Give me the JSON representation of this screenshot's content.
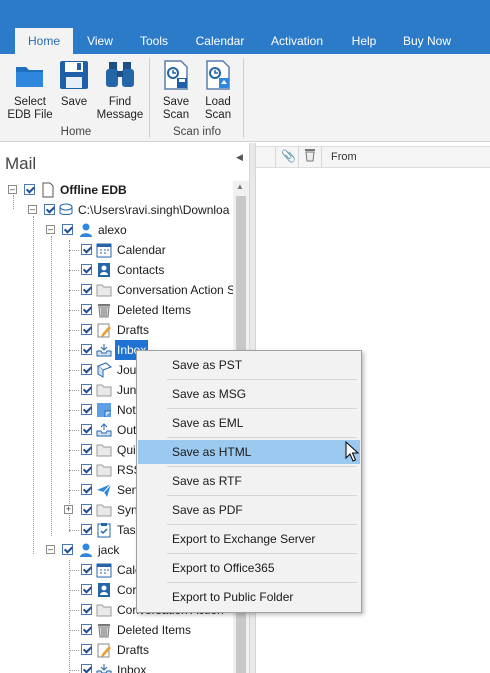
{
  "ribbon": {
    "tabs": [
      {
        "label": "Home",
        "active": true
      },
      {
        "label": "View"
      },
      {
        "label": "Tools"
      },
      {
        "label": "Calendar"
      },
      {
        "label": "Activation"
      },
      {
        "label": "Help"
      },
      {
        "label": "Buy Now"
      }
    ],
    "groups": {
      "home": {
        "label": "Home",
        "buttons": {
          "select_edb": {
            "line1": "Select",
            "line2": "EDB File",
            "icon": "folder-open-icon"
          },
          "save": {
            "line1": "Save",
            "line2": "",
            "icon": "floppy-disk-icon"
          },
          "find_message": {
            "line1": "Find",
            "line2": "Message",
            "icon": "binoculars-icon"
          }
        }
      },
      "scan_info": {
        "label": "Scan info",
        "buttons": {
          "save_scan": {
            "line1": "Save",
            "line2": "Scan",
            "icon": "save-scan-icon"
          },
          "load_scan": {
            "line1": "Load",
            "line2": "Scan",
            "icon": "load-scan-icon"
          }
        }
      }
    },
    "accent": "#2b7bc9"
  },
  "left_pane": {
    "title": "Mail",
    "tree": {
      "root": "Offline EDB",
      "path": "C:\\Users\\ravi.singh\\Downloa",
      "mailbox1": {
        "name": "alexo",
        "folders": [
          "Calendar",
          "Contacts",
          "Conversation Action S",
          "Deleted Items",
          "Drafts",
          "Inbox",
          "Jou",
          "Jun",
          "Not",
          "Out",
          "Qui",
          "RSS",
          "Sen",
          "Syn",
          "Tasl"
        ]
      },
      "mailbox2": {
        "name": "jack",
        "folders": [
          "Cale",
          "Cor",
          "Conversation Action",
          "Deleted Items",
          "Drafts",
          "Inbox"
        ]
      }
    }
  },
  "list_header": {
    "from_label": "From"
  },
  "context_menu": {
    "items": [
      {
        "label": "Save as PST"
      },
      {
        "label": "Save as MSG"
      },
      {
        "label": "Save as EML"
      },
      {
        "label": "Save as HTML",
        "highlighted": true
      },
      {
        "label": "Save as RTF"
      },
      {
        "label": "Save as PDF"
      },
      {
        "label": "Export to Exchange Server"
      },
      {
        "label": "Export to Office365"
      },
      {
        "label": "Export to Public Folder"
      }
    ]
  }
}
